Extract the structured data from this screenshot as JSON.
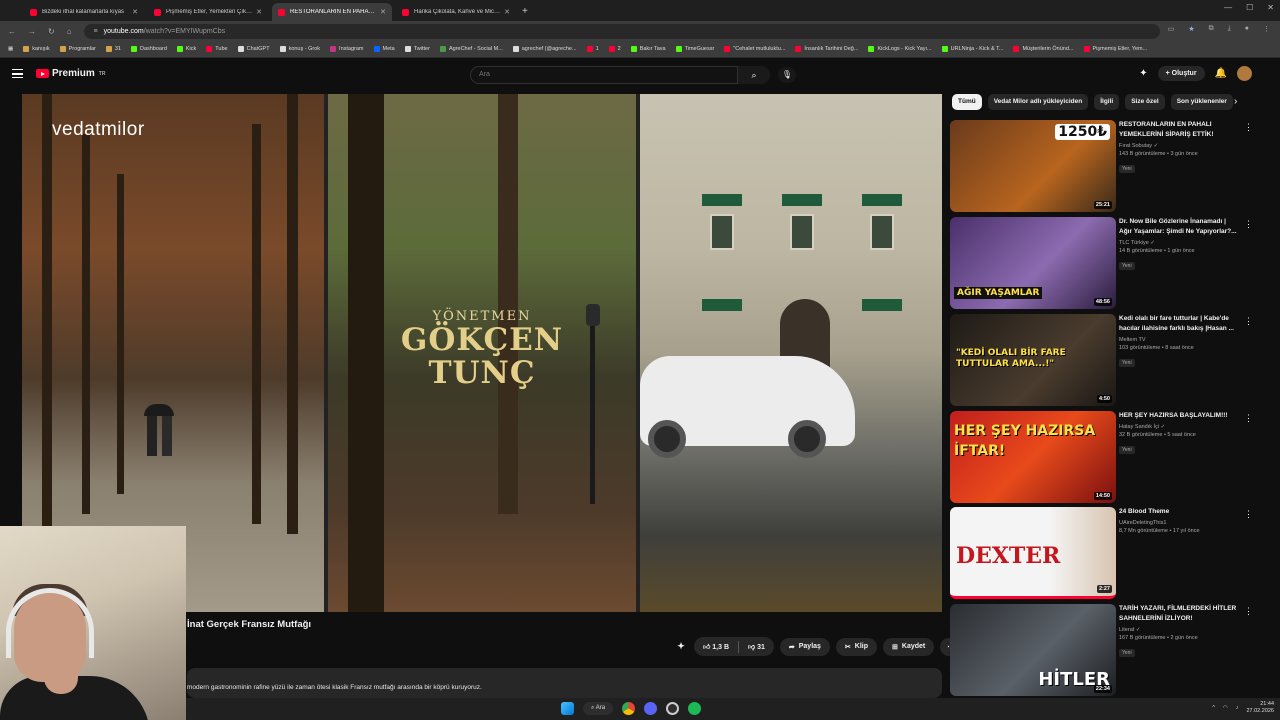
{
  "browser": {
    "tabs": [
      {
        "label": "Bizdeki ithal kalamarlarla kıyas",
        "active": false
      },
      {
        "label": "Pişmemiş Etler, Yemekten Çıkan",
        "active": false
      },
      {
        "label": "RESTORANLARIN EN PAHALI YEMEKLERİ",
        "active": true
      },
      {
        "label": "Harika Çikolata, Kahve ve Michelin",
        "active": false
      }
    ],
    "url_host": "youtube.com",
    "url_path": "/watch?v=EMYIWupmCbs",
    "bookmarks": [
      "kanışık",
      "Programlar",
      "31",
      "Dashboard",
      "Kick",
      "Tube",
      "ChatGPT",
      "konuş - Grok",
      "Instagram",
      "Meta",
      "Twitter",
      "AgreChef - Social M...",
      "agrechef (@agreche...",
      "1",
      "2",
      "Bakır Tava",
      "TimeGuessr",
      "\"Cehalet mutluluktu...",
      "İnsanlık Tarihini Değ...",
      "KickLogs - Kick Yayı...",
      "URLNinja - Kick & T...",
      "Müşterilerin Önünd...",
      "Pişmemiş Etler, Yem..."
    ]
  },
  "youtube": {
    "logo": "Premium",
    "logo_suffix": "TR",
    "search_placeholder": "Ara",
    "create_label": "Oluştur"
  },
  "video": {
    "watermark": "vedatmilor",
    "credit_role": "YÖNETMEN",
    "credit_name_1": "GÖKÇEN",
    "credit_name_2": "TUNÇ",
    "title": "İnat Gerçek Fransız Mutfağı",
    "likes": "1,3 B",
    "dislikes": "31",
    "share_label": "Paylaş",
    "clip_label": "Klip",
    "save_label": "Kaydet",
    "description": "modern gastronominin rafine yüzü ile zaman ötesi klasik Fransız mutfağı arasında bir köprü kuruyoruz."
  },
  "chips": [
    "Tümü",
    "Vedat Milor adlı yükleyiciden",
    "İlgili",
    "Size özel",
    "Son yüklenenler"
  ],
  "recommendations": [
    {
      "title": "RESTORANLARIN EN PAHALI YEMEKLERİNİ SİPARİŞ ETTİK!",
      "channel": "Fırat Sobutay",
      "views": "143 B görüntüleme • 3 gün önce",
      "badge": "Yeni",
      "duration": "25:21",
      "thumb_text": "1250₺",
      "color": "#a8521e"
    },
    {
      "title": "Dr. Now Bile Gözlerine İnanamadı | Ağır Yaşamlar: Şimdi Ne Yapıyorlar?...",
      "channel": "TLC Türkiye",
      "views": "14 B görüntüleme • 1 gün önce",
      "badge": "Yeni",
      "duration": "48:56",
      "thumb_text": "AĞIR YAŞAMLAR",
      "color": "#5a3d7a"
    },
    {
      "title": "Kedi olalı bir fare tutturlar | Kabe'de hacılar ilahisine farklı bakış |Hasan ...",
      "channel": "Meltem TV",
      "views": "103 görüntüleme • 8 saat önce",
      "badge": "Yeni",
      "duration": "4:50",
      "thumb_text": "\"KEDİ OLALI BİR FARE TUTTULAR AMA...!\"",
      "color": "#2a2620"
    },
    {
      "title": "HER ŞEY HAZIRSA BAŞLAYALIM!!!",
      "channel": "Hatay Sandık İçi",
      "views": "32 B görüntüleme • 5 saat önce",
      "badge": "Yeni",
      "duration": "14:50",
      "thumb_text": "HER ŞEY HAZIRSA İFTAR!",
      "color": "#b01818"
    },
    {
      "title": "24 Blood Theme",
      "channel": "UAireDeletingThis1",
      "views": "8,7 Mn görüntüleme • 17 yıl önce",
      "badge": "",
      "duration": "2:27",
      "thumb_text": "DEXTER",
      "color": "#f2f2f2"
    },
    {
      "title": "TARİH YAZARI, FİLMLERDEKİ HİTLER SAHNELERİNİ İZLİYOR!",
      "channel": "Literat",
      "views": "167 B görüntüleme • 2 gün önce",
      "badge": "Yeni",
      "duration": "22:34",
      "thumb_text": "HİTLER",
      "color": "#2c2f33"
    }
  ],
  "taskbar": {
    "search_label": "Ara",
    "time": "21:44",
    "date": "27.02.2026"
  }
}
